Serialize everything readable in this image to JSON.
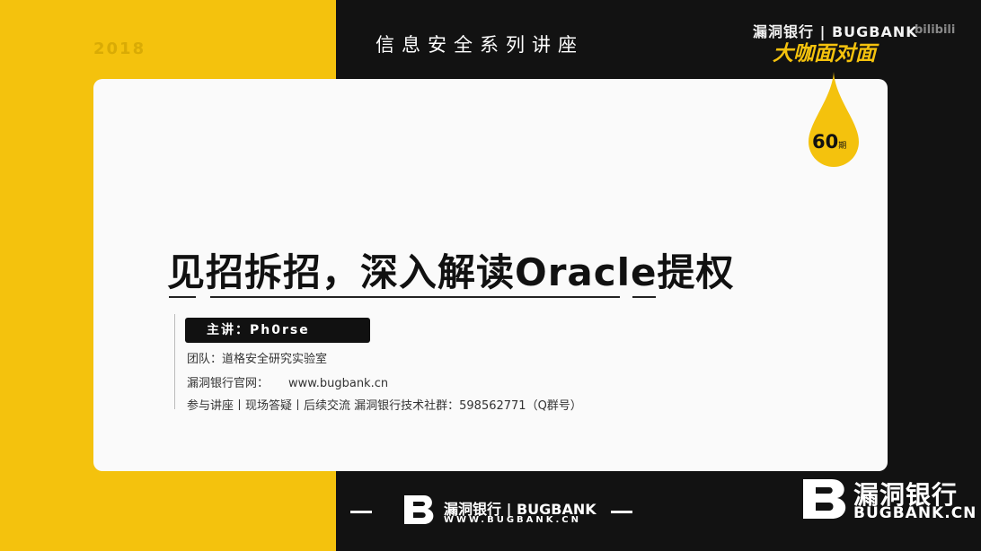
{
  "header": {
    "year": "2018",
    "series_title": "信息安全系列讲座",
    "brand_top": "漏洞银行 | BUGBANK",
    "bilibili": "bilibili",
    "show_name": "大咖面对面"
  },
  "badge": {
    "number": "60",
    "unit": "期"
  },
  "main": {
    "title": "见招拆招，深入解读Oracle提权",
    "presenter": "主讲：Ph0rse",
    "team": "团队：道格安全研究实验室",
    "site_label": "漏洞银行官网：",
    "site_url": "www.bugbank.cn",
    "extra": "参与讲座丨现场答疑丨后续交流  漏洞银行技术社群：598562771（Q群号）"
  },
  "footer": {
    "logo_icon": "bugbank-b-logo",
    "name": "漏洞银行 | BUGBANK",
    "url": "WWW.BUGBANK.CN",
    "corner_name": "漏洞银行",
    "corner_url": "BUGBANK.CN"
  },
  "colors": {
    "accent": "#f4c20d",
    "dark": "#121212",
    "card": "#fafafa"
  }
}
